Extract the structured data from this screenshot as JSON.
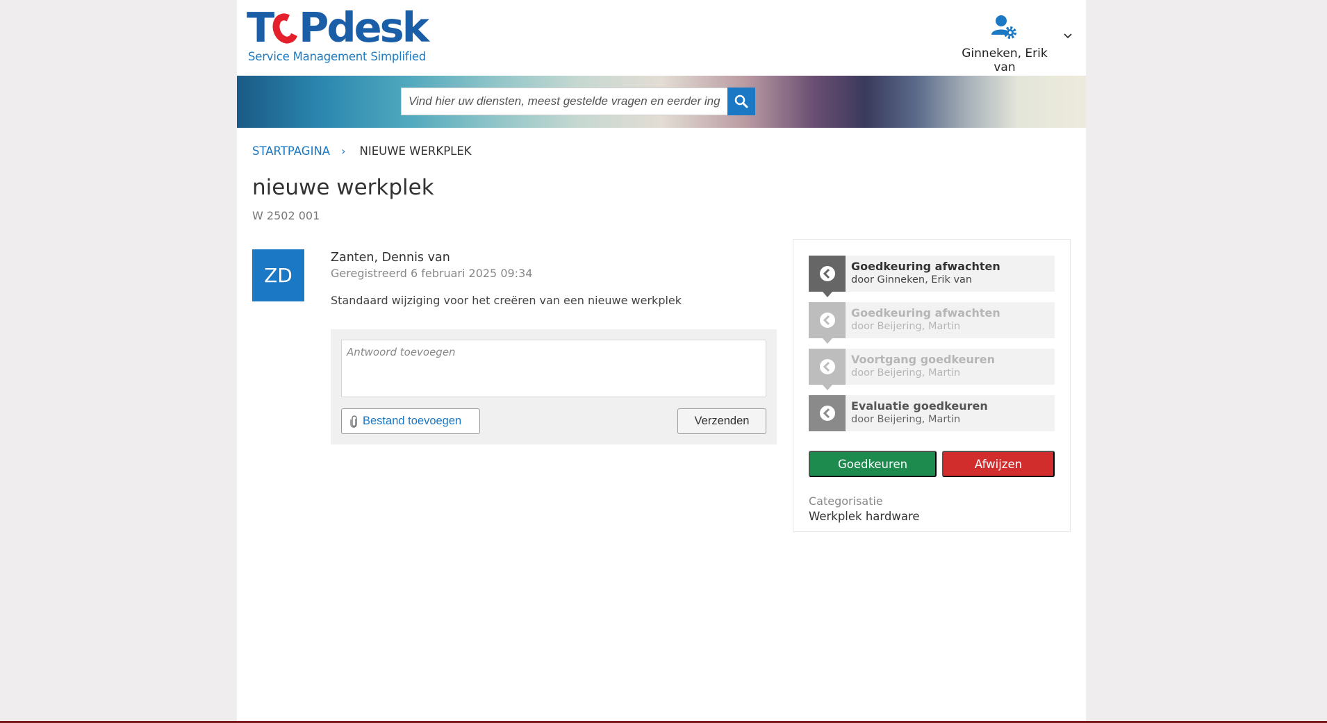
{
  "header": {
    "logo_text_left": "T",
    "logo_text_right": "Pdesk",
    "logo_tagline": "Service Management Simplified",
    "user_name": "Ginneken, Erik van",
    "user_icon": "user-gear-icon",
    "chevron_icon": "chevron-down-icon"
  },
  "search": {
    "placeholder": "Vind hier uw diensten, meest gestelde vragen en eerder ingediende verzoeken",
    "icon": "search-icon"
  },
  "breadcrumb": {
    "home": "STARTPAGINA",
    "separator": "›",
    "current": "NIEUWE WERKPLEK"
  },
  "page": {
    "title": "nieuwe werkplek",
    "reference": "W 2502 001"
  },
  "request": {
    "avatar_initials": "ZD",
    "requester": "Zanten, Dennis van",
    "registered": "Geregistreerd 6 februari 2025 09:34",
    "description": "Standaard wijziging voor het creëren van een nieuwe werkplek"
  },
  "reply": {
    "placeholder": "Antwoord toevoegen",
    "attach_label": "Bestand toevoegen",
    "send_label": "Verzenden"
  },
  "approval": {
    "steps": [
      {
        "title": "Goedkeuring afwachten",
        "by": "door Ginneken, Erik van",
        "state": "active"
      },
      {
        "title": "Goedkeuring afwachten",
        "by": "door Beijering, Martin",
        "state": "inactive"
      },
      {
        "title": "Voortgang goedkeuren",
        "by": "door Beijering, Martin",
        "state": "inactive"
      },
      {
        "title": "Evaluatie goedkeuren",
        "by": "door Beijering, Martin",
        "state": "partial"
      }
    ],
    "approve_label": "Goedkeuren",
    "reject_label": "Afwijzen",
    "category_label": "Categorisatie",
    "category_value": "Werkplek hardware"
  },
  "colors": {
    "brand_blue": "#1b78c4",
    "logo_red": "#e3202b",
    "approve_green": "#1d8a4e",
    "reject_red": "#d12d2d"
  }
}
